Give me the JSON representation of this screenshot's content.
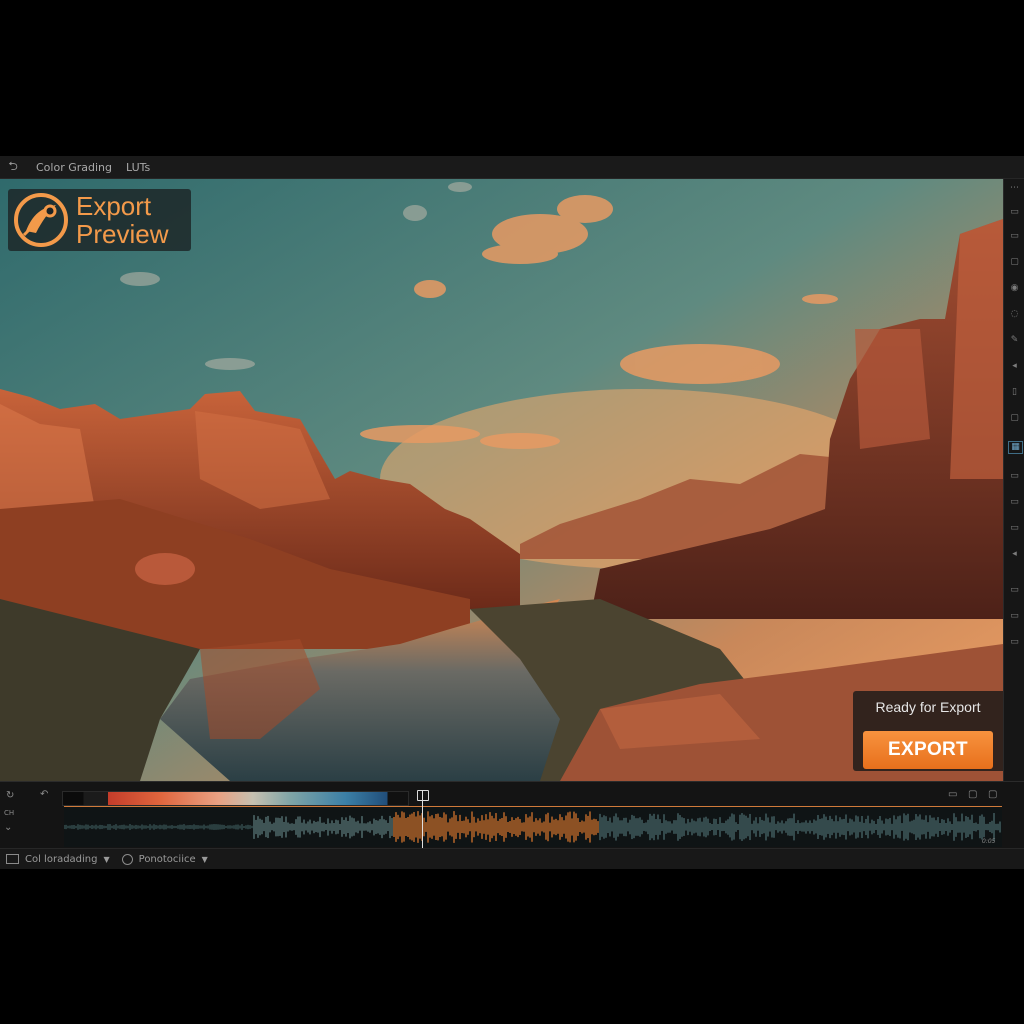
{
  "menubar": {
    "back_icon": "back-arrow-icon",
    "items": [
      "Color Grading",
      "LUTs"
    ]
  },
  "overlay": {
    "logo_line1": "Export",
    "logo_line2": "Preview",
    "brand_color": "#f39a4a"
  },
  "export_panel": {
    "status": "Ready for Export",
    "button_label": "EXPORT",
    "button_color": "#f08a32"
  },
  "timeline": {
    "label_left": "CH",
    "readout_right": "0:05"
  },
  "bottombar": {
    "workspace_label": "Col loradading",
    "preset_label": "Ponotociice"
  }
}
